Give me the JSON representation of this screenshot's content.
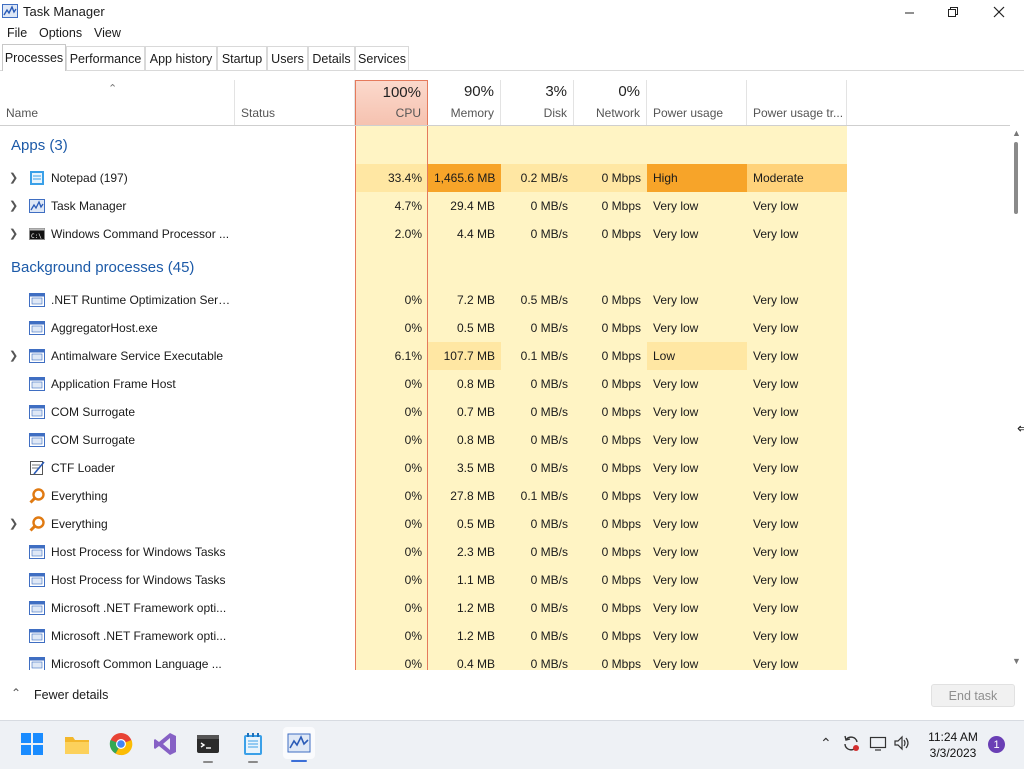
{
  "window": {
    "title": "Task Manager"
  },
  "menu": {
    "file": "File",
    "options": "Options",
    "view": "View"
  },
  "tabs": [
    "Processes",
    "Performance",
    "App history",
    "Startup",
    "Users",
    "Details",
    "Services"
  ],
  "columns": {
    "name": "Name",
    "status": "Status",
    "cpu_pct": "100%",
    "cpu": "CPU",
    "memory_pct": "90%",
    "memory": "Memory",
    "disk_pct": "3%",
    "disk": "Disk",
    "network_pct": "0%",
    "network": "Network",
    "power": "Power usage",
    "power_trend": "Power usage tr..."
  },
  "groups": {
    "apps": "Apps (3)",
    "background": "Background processes (45)"
  },
  "apps": [
    {
      "name": "Notepad (197)",
      "cpu": "33.4%",
      "memory": "1,465.6 MB",
      "disk": "0.2 MB/s",
      "network": "0 Mbps",
      "power": "High",
      "trend": "Moderate"
    },
    {
      "name": "Task Manager",
      "cpu": "4.7%",
      "memory": "29.4 MB",
      "disk": "0 MB/s",
      "network": "0 Mbps",
      "power": "Very low",
      "trend": "Very low"
    },
    {
      "name": "Windows Command Processor ...",
      "cpu": "2.0%",
      "memory": "4.4 MB",
      "disk": "0 MB/s",
      "network": "0 Mbps",
      "power": "Very low",
      "trend": "Very low"
    }
  ],
  "background": [
    {
      "name": ".NET Runtime Optimization Serv...",
      "cpu": "0%",
      "memory": "7.2 MB",
      "disk": "0.5 MB/s",
      "network": "0 Mbps",
      "power": "Very low",
      "trend": "Very low"
    },
    {
      "name": "AggregatorHost.exe",
      "cpu": "0%",
      "memory": "0.5 MB",
      "disk": "0 MB/s",
      "network": "0 Mbps",
      "power": "Very low",
      "trend": "Very low"
    },
    {
      "name": "Antimalware Service Executable",
      "cpu": "6.1%",
      "memory": "107.7 MB",
      "disk": "0.1 MB/s",
      "network": "0 Mbps",
      "power": "Low",
      "trend": "Very low"
    },
    {
      "name": "Application Frame Host",
      "cpu": "0%",
      "memory": "0.8 MB",
      "disk": "0 MB/s",
      "network": "0 Mbps",
      "power": "Very low",
      "trend": "Very low"
    },
    {
      "name": "COM Surrogate",
      "cpu": "0%",
      "memory": "0.7 MB",
      "disk": "0 MB/s",
      "network": "0 Mbps",
      "power": "Very low",
      "trend": "Very low"
    },
    {
      "name": "COM Surrogate",
      "cpu": "0%",
      "memory": "0.8 MB",
      "disk": "0 MB/s",
      "network": "0 Mbps",
      "power": "Very low",
      "trend": "Very low"
    },
    {
      "name": "CTF Loader",
      "cpu": "0%",
      "memory": "3.5 MB",
      "disk": "0 MB/s",
      "network": "0 Mbps",
      "power": "Very low",
      "trend": "Very low"
    },
    {
      "name": "Everything",
      "cpu": "0%",
      "memory": "27.8 MB",
      "disk": "0.1 MB/s",
      "network": "0 Mbps",
      "power": "Very low",
      "trend": "Very low"
    },
    {
      "name": "Everything",
      "cpu": "0%",
      "memory": "0.5 MB",
      "disk": "0 MB/s",
      "network": "0 Mbps",
      "power": "Very low",
      "trend": "Very low"
    },
    {
      "name": "Host Process for Windows Tasks",
      "cpu": "0%",
      "memory": "2.3 MB",
      "disk": "0 MB/s",
      "network": "0 Mbps",
      "power": "Very low",
      "trend": "Very low"
    },
    {
      "name": "Host Process for Windows Tasks",
      "cpu": "0%",
      "memory": "1.1 MB",
      "disk": "0 MB/s",
      "network": "0 Mbps",
      "power": "Very low",
      "trend": "Very low"
    },
    {
      "name": "Microsoft .NET Framework opti...",
      "cpu": "0%",
      "memory": "1.2 MB",
      "disk": "0 MB/s",
      "network": "0 Mbps",
      "power": "Very low",
      "trend": "Very low"
    },
    {
      "name": "Microsoft .NET Framework opti...",
      "cpu": "0%",
      "memory": "1.2 MB",
      "disk": "0 MB/s",
      "network": "0 Mbps",
      "power": "Very low",
      "trend": "Very low"
    },
    {
      "name": "Microsoft Common Language ...",
      "cpu": "0%",
      "memory": "0.4 MB",
      "disk": "0 MB/s",
      "network": "0 Mbps",
      "power": "Very low",
      "trend": "Very low"
    }
  ],
  "footer": {
    "fewer_details": "Fewer details",
    "end_task": "End task"
  },
  "clock": {
    "time": "11:24 AM",
    "date": "3/3/2023"
  },
  "notifications": {
    "count": "1"
  },
  "colors": {
    "heat_low": "#fff4c4",
    "heat_mid": "#ffe7a3",
    "heat_high": "#ffd27a",
    "power_high": "#f7a429",
    "cpu_header": "#f9d3c5",
    "group_title": "#1c5aa8"
  }
}
